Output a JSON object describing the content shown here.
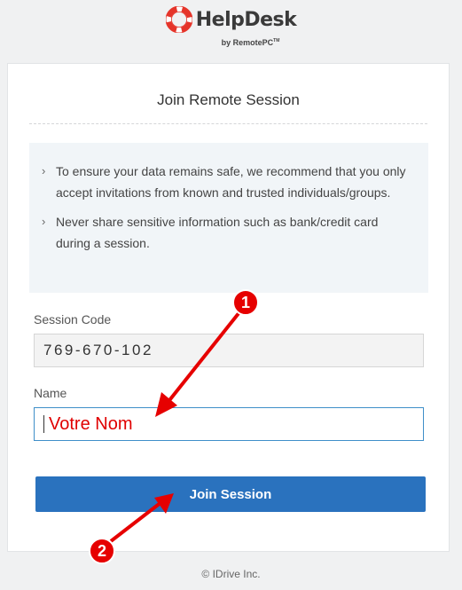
{
  "brand": {
    "name": "HelpDesk",
    "sub": "by RemotePC",
    "sub_tm": "TM",
    "colors": {
      "ring": "#e5342a",
      "text": "#3a3a3a"
    }
  },
  "card": {
    "title": "Join Remote Session",
    "notices": [
      "To ensure your data remains safe, we recommend that you only accept invitations from known and trusted individuals/groups.",
      "Never share sensitive information such as bank/credit card during a session."
    ],
    "session_code": {
      "label": "Session Code",
      "value": "769-670-102"
    },
    "name": {
      "label": "Name",
      "value": "Votre Nom"
    },
    "join_label": "Join Session"
  },
  "annotations": {
    "marker_1": "1",
    "marker_2": "2",
    "color": "#e60000"
  },
  "footer": "© IDrive Inc.",
  "colors": {
    "button": "#2a72be",
    "input_focus": "#3f8fc9",
    "background": "#f0f1f2"
  }
}
